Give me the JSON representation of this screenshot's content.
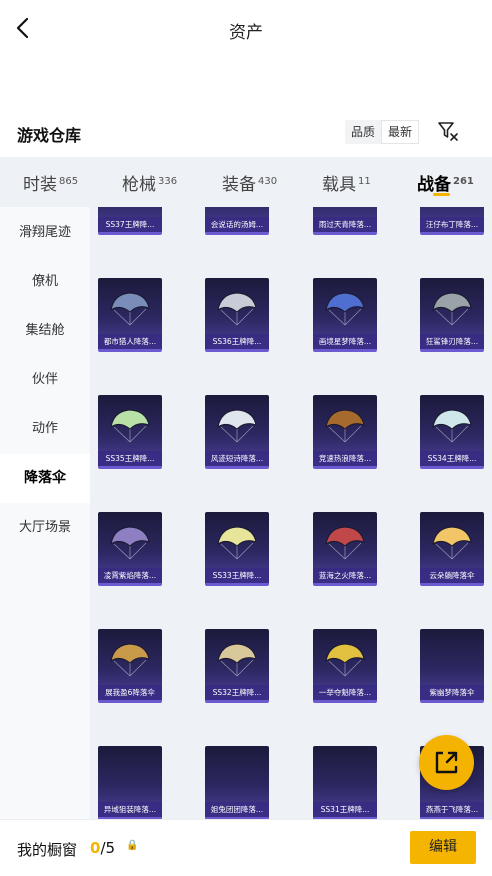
{
  "header": {
    "title": "资产"
  },
  "section": {
    "title": "游戏仓库"
  },
  "sort": {
    "options": [
      "品质",
      "最新"
    ],
    "selected": "最新"
  },
  "tabs": [
    {
      "label": "时装",
      "count": "865"
    },
    {
      "label": "枪械",
      "count": "336"
    },
    {
      "label": "装备",
      "count": "430"
    },
    {
      "label": "载具",
      "count": "11"
    },
    {
      "label": "战备",
      "count": "261",
      "active": true
    }
  ],
  "sidebar": {
    "items": [
      {
        "label": "滑翔尾迹"
      },
      {
        "label": "僚机"
      },
      {
        "label": "集结舱"
      },
      {
        "label": "伙伴"
      },
      {
        "label": "动作"
      },
      {
        "label": "降落伞",
        "active": true
      },
      {
        "label": "大厅场景"
      }
    ]
  },
  "items": [
    {
      "label": "SS37王牌降..."
    },
    {
      "label": "会说话的汤姆..."
    },
    {
      "label": "雨过天青降落..."
    },
    {
      "label": "汪仔布丁降落..."
    },
    {
      "label": "都市猎人降落...",
      "color": "#7a8db8"
    },
    {
      "label": "SS36王牌降...",
      "color": "#c9cbd6"
    },
    {
      "label": "画境星梦降落...",
      "color": "#4f6fd0"
    },
    {
      "label": "狂鲨锋刃降落...",
      "color": "#9aa3a8"
    },
    {
      "label": "SS35王牌降...",
      "color": "#b9e0a6"
    },
    {
      "label": "风迹短诗降落...",
      "color": "#dfe6ee"
    },
    {
      "label": "竞速热浪降落...",
      "color": "#a66a2c"
    },
    {
      "label": "SS34王牌降...",
      "color": "#cfe7ea"
    },
    {
      "label": "凌霄紫焰降落...",
      "color": "#8e7fc2"
    },
    {
      "label": "SS33王牌降...",
      "color": "#e6e59a"
    },
    {
      "label": "蓝海之火降落...",
      "color": "#c04848"
    },
    {
      "label": "云朵躺降落伞",
      "color": "#f2c566"
    },
    {
      "label": "展我盈6降落伞",
      "color": "#c99a4a"
    },
    {
      "label": "SS32王牌降...",
      "color": "#d8c89a"
    },
    {
      "label": "一举夺魁降落...",
      "color": "#e2c040"
    },
    {
      "label": "紫幽梦降落伞"
    },
    {
      "label": "异域狙装降落..."
    },
    {
      "label": "姐兔团团降落..."
    },
    {
      "label": "SS31王牌降..."
    },
    {
      "label": "燕燕于飞降落..."
    }
  ],
  "showcase": {
    "label": "我的橱窗",
    "current": "0",
    "total": "/5",
    "lock": "🔒"
  },
  "buttons": {
    "edit": "编辑"
  },
  "colors": {
    "accent": "#f4b400",
    "card": "#2c2760"
  },
  "icons": {
    "back": "back-arrow-icon",
    "filter": "filter-icon",
    "share": "external-link-icon"
  }
}
